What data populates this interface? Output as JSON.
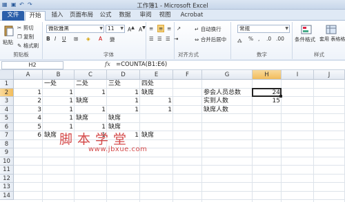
{
  "window": {
    "title": "工作簿1 - Microsoft Excel"
  },
  "tabs": [
    "文件",
    "开始",
    "插入",
    "页面布局",
    "公式",
    "数据",
    "审阅",
    "视图",
    "Acrobat"
  ],
  "ribbon": {
    "clipboard": {
      "paste": "粘贴",
      "cut": "剪切",
      "copy": "复制",
      "format_painter": "格式刷",
      "label": "剪贴板"
    },
    "font": {
      "name": "微软雅黑",
      "size": "11",
      "label": "字体"
    },
    "alignment": {
      "wrap": "自动换行",
      "merge": "合并后居中",
      "label": "对齐方式"
    },
    "number": {
      "format": "常规",
      "label": "数字"
    },
    "styles": {
      "conditional": "条件格式",
      "table_format": "套用 表格格式",
      "label": "样式"
    }
  },
  "formula_bar": {
    "name_box": "H2",
    "fx": "fx",
    "formula": "=COUNTA(B1:E6)"
  },
  "grid": {
    "columns": [
      "A",
      "B",
      "C",
      "D",
      "E",
      "F",
      "G",
      "H",
      "I",
      "J"
    ],
    "rows": [
      "1",
      "2",
      "3",
      "4",
      "5",
      "6",
      "7",
      "8",
      "9",
      "10",
      "11",
      "12",
      "13",
      "14"
    ],
    "selected_column": "H",
    "selected_row": "2",
    "active_cell": "H2",
    "cells": [
      {
        "ref": "B1",
        "text": "一处"
      },
      {
        "ref": "C1",
        "text": "二处"
      },
      {
        "ref": "D1",
        "text": "三处"
      },
      {
        "ref": "E1",
        "text": "四处"
      },
      {
        "ref": "A2",
        "text": "1"
      },
      {
        "ref": "B2",
        "text": "1"
      },
      {
        "ref": "C2",
        "text": "1"
      },
      {
        "ref": "D2",
        "text": "1"
      },
      {
        "ref": "E2",
        "text": "缺席"
      },
      {
        "ref": "G2",
        "text": "参会人员总数"
      },
      {
        "ref": "H2",
        "text": "24"
      },
      {
        "ref": "A3",
        "text": "2"
      },
      {
        "ref": "B3",
        "text": "1"
      },
      {
        "ref": "C3",
        "text": "缺席"
      },
      {
        "ref": "D3",
        "text": "1"
      },
      {
        "ref": "E3",
        "text": "1"
      },
      {
        "ref": "G3",
        "text": "实到人数"
      },
      {
        "ref": "H3",
        "text": "15"
      },
      {
        "ref": "A4",
        "text": "3"
      },
      {
        "ref": "B4",
        "text": "1"
      },
      {
        "ref": "C4",
        "text": "1"
      },
      {
        "ref": "D4",
        "text": "1"
      },
      {
        "ref": "E4",
        "text": "1"
      },
      {
        "ref": "G4",
        "text": "缺席人数"
      },
      {
        "ref": "A5",
        "text": "4"
      },
      {
        "ref": "B5",
        "text": "1"
      },
      {
        "ref": "C5",
        "text": "缺席"
      },
      {
        "ref": "D5",
        "text": "缺席"
      },
      {
        "ref": "A6",
        "text": "5"
      },
      {
        "ref": "B6",
        "text": "1"
      },
      {
        "ref": "C6",
        "text": "1"
      },
      {
        "ref": "D6",
        "text": "缺席"
      },
      {
        "ref": "A7",
        "text": "6"
      },
      {
        "ref": "B7",
        "text": "缺席"
      },
      {
        "ref": "C7",
        "text": "1"
      },
      {
        "ref": "D7",
        "text": "1"
      },
      {
        "ref": "E7",
        "text": "缺席"
      }
    ]
  },
  "watermark": {
    "text": "脚本学堂",
    "url": "www.jbxue.com"
  }
}
